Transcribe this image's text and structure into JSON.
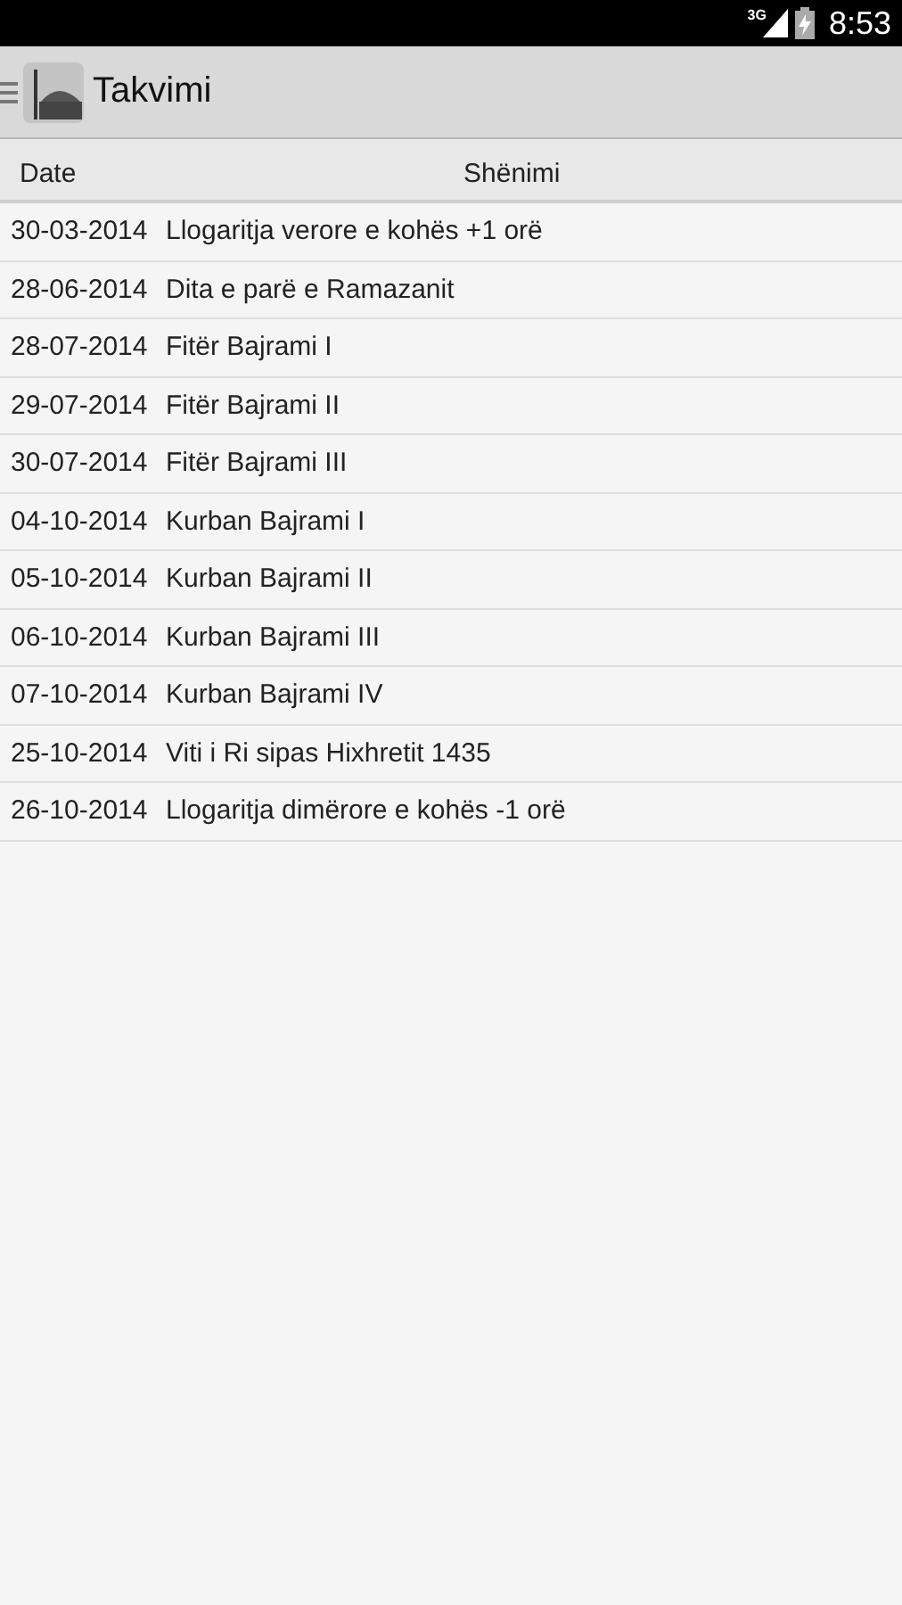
{
  "status_bar": {
    "network": "3G",
    "time": "8:53"
  },
  "app_bar": {
    "title": "Takvimi"
  },
  "table": {
    "columns": [
      "Date",
      "Shënimi"
    ],
    "rows": [
      {
        "date": "30-03-2014",
        "note": "Llogaritja verore e kohës +1 orë"
      },
      {
        "date": "28-06-2014",
        "note": "Dita e parë e Ramazanit"
      },
      {
        "date": "28-07-2014",
        "note": "Fitër Bajrami I"
      },
      {
        "date": "29-07-2014",
        "note": "Fitër Bajrami II"
      },
      {
        "date": "30-07-2014",
        "note": "Fitër Bajrami III"
      },
      {
        "date": "04-10-2014",
        "note": "Kurban Bajrami I"
      },
      {
        "date": "05-10-2014",
        "note": "Kurban Bajrami II"
      },
      {
        "date": "06-10-2014",
        "note": "Kurban Bajrami III"
      },
      {
        "date": "07-10-2014",
        "note": "Kurban Bajrami IV"
      },
      {
        "date": "25-10-2014",
        "note": "Viti i Ri sipas Hixhretit 1435"
      },
      {
        "date": "26-10-2014",
        "note": "Llogaritja dimërore e kohës -1 orë"
      }
    ]
  }
}
